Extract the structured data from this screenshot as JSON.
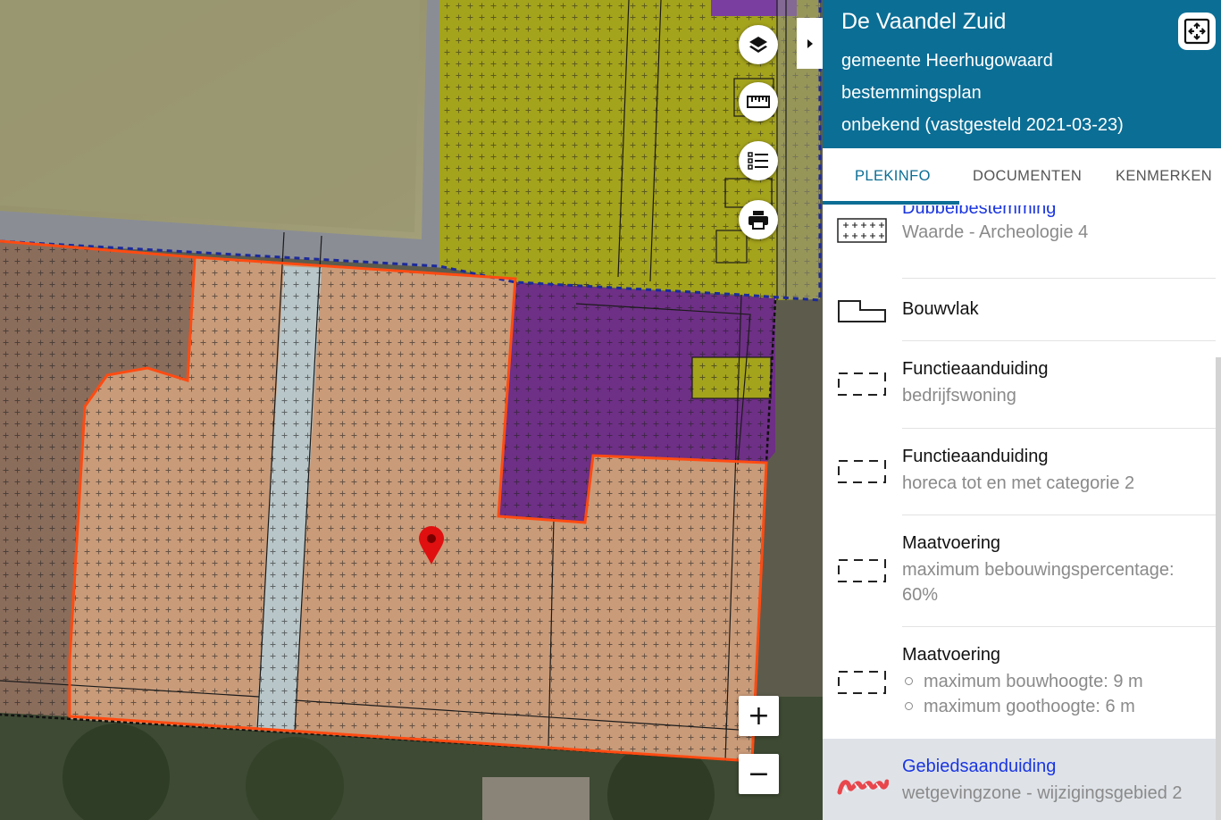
{
  "map": {
    "marker_label": "location-marker"
  },
  "controls": {
    "zoom_in": "+",
    "zoom_out": "−"
  },
  "panel": {
    "title": "De Vaandel Zuid",
    "municipality": "gemeente Heerhugowaard",
    "plan_type": "bestemmingsplan",
    "status": "onbekend (vastgesteld 2021-03-23)",
    "header_color": "#0b6e95"
  },
  "tabs": [
    {
      "label": "PLEKINFO"
    },
    {
      "label": "DOCUMENTEN"
    },
    {
      "label": "KENMERKEN"
    }
  ],
  "legend": [
    {
      "title": "Dubbelbestemming",
      "sub": "Waarde - Archeologie 4",
      "icon": "cross-grid-icon",
      "link": true
    },
    {
      "title": "Bouwvlak",
      "icon": "building-outline-icon"
    },
    {
      "title": "Functieaanduiding",
      "sub": "bedrijfswoning",
      "icon": "dashed-box-icon"
    },
    {
      "title": "Functieaanduiding",
      "sub": "horeca tot en met categorie 2",
      "icon": "dashed-box-icon"
    },
    {
      "title": "Maatvoering",
      "sub_lines": [
        "maximum bebouwingspercentage:",
        "60%"
      ],
      "icon": "dashed-box-icon"
    },
    {
      "title": "Maatvoering",
      "bullets": [
        "maximum bouwhoogte: 9 m",
        "maximum goothoogte: 6 m"
      ],
      "icon": "dashed-box-icon"
    },
    {
      "title": "Gebiedsaanduiding",
      "sub": "wetgevingzone - wijzigingsgebied 2",
      "icon": "zigzag-area-icon",
      "link": true,
      "highlighted": true
    }
  ]
}
